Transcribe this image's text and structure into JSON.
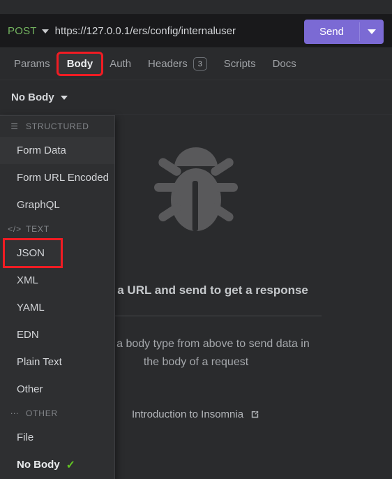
{
  "window": {
    "background": "#2a2b2d"
  },
  "request_bar": {
    "method": "POST",
    "method_caret_icon": "chevron-down-icon",
    "url": "https://127.0.0.1/ers/config/internaluser",
    "send_label": "Send",
    "send_caret_icon": "chevron-down-icon",
    "method_color": "#74b560",
    "send_color": "#7b6ad4"
  },
  "tabs": [
    {
      "label": "Params",
      "active": false,
      "badge": null,
      "highlighted": false
    },
    {
      "label": "Body",
      "active": true,
      "badge": null,
      "highlighted": true
    },
    {
      "label": "Auth",
      "active": false,
      "badge": null,
      "highlighted": false
    },
    {
      "label": "Headers",
      "active": false,
      "badge": "3",
      "highlighted": false
    },
    {
      "label": "Scripts",
      "active": false,
      "badge": null,
      "highlighted": false
    },
    {
      "label": "Docs",
      "active": false,
      "badge": null,
      "highlighted": false
    }
  ],
  "body_type_row": {
    "label": "No Body",
    "caret_icon": "chevron-down-icon"
  },
  "body_menu": {
    "sections": [
      {
        "icon": "hamburger-icon",
        "icon_glyph": "☰",
        "title": "STRUCTURED",
        "items": [
          {
            "label": "Form Data",
            "state": "hover"
          },
          {
            "label": "Form URL Encoded",
            "state": "normal"
          },
          {
            "label": "GraphQL",
            "state": "normal"
          }
        ]
      },
      {
        "icon": "code-icon",
        "icon_glyph": "</>",
        "title": "TEXT",
        "items": [
          {
            "label": "JSON",
            "state": "highlighted"
          },
          {
            "label": "XML",
            "state": "normal"
          },
          {
            "label": "YAML",
            "state": "normal"
          },
          {
            "label": "EDN",
            "state": "normal"
          },
          {
            "label": "Plain Text",
            "state": "normal"
          },
          {
            "label": "Other",
            "state": "normal"
          }
        ]
      },
      {
        "icon": "ellipsis-icon",
        "icon_glyph": "⋯",
        "title": "OTHER",
        "items": [
          {
            "label": "File",
            "state": "normal"
          },
          {
            "label": "No Body",
            "state": "selected",
            "check_icon": "check-icon",
            "check_glyph": "✓"
          }
        ]
      }
    ]
  },
  "empty_state": {
    "logo_icon": "insomnia-bug-icon",
    "title": "Enter a URL and send to get a response",
    "subtitle": "Select a body type from above to send data in the body of a request",
    "doc_link": "Introduction to Insomnia",
    "doc_link_icon": "external-link-icon"
  },
  "highlight_color": "#f01c23"
}
